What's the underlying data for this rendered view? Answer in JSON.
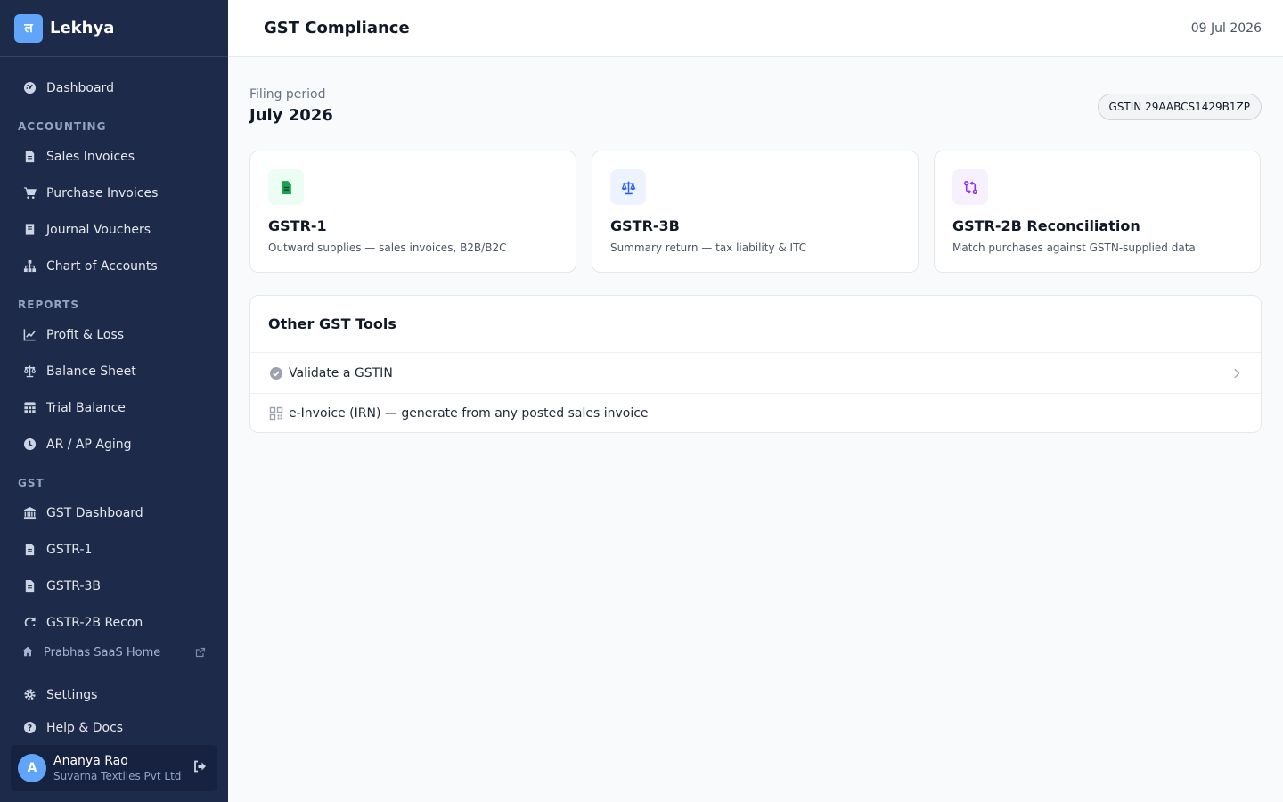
{
  "brand": {
    "logo_glyph": "ल",
    "name": "Lekhya",
    "accent": "#60a5fa"
  },
  "sidebar": {
    "items": [
      {
        "type": "item",
        "label": "Dashboard",
        "icon": "dashboard-gauge-icon"
      },
      {
        "type": "section",
        "label": "ACCOUNTING"
      },
      {
        "type": "item",
        "label": "Sales Invoices",
        "icon": "file-icon"
      },
      {
        "type": "item",
        "label": "Purchase Invoices",
        "icon": "cart-icon"
      },
      {
        "type": "item",
        "label": "Journal Vouchers",
        "icon": "book-icon"
      },
      {
        "type": "item",
        "label": "Chart of Accounts",
        "icon": "sitemap-icon"
      },
      {
        "type": "section",
        "label": "REPORTS"
      },
      {
        "type": "item",
        "label": "Profit & Loss",
        "icon": "line-chart-icon"
      },
      {
        "type": "item",
        "label": "Balance Sheet",
        "icon": "scale-icon"
      },
      {
        "type": "item",
        "label": "Trial Balance",
        "icon": "table-icon"
      },
      {
        "type": "item",
        "label": "AR / AP Aging",
        "icon": "clock-icon"
      },
      {
        "type": "section",
        "label": "GST"
      },
      {
        "type": "item",
        "label": "GST Dashboard",
        "icon": "bank-icon"
      },
      {
        "type": "item",
        "label": "GSTR-1",
        "icon": "file-icon"
      },
      {
        "type": "item",
        "label": "GSTR-3B",
        "icon": "file-icon"
      },
      {
        "type": "item",
        "label": "GSTR-2B Recon",
        "icon": "refresh-icon"
      }
    ],
    "saas_link": "Prabhas SaaS Home",
    "settings": "Settings",
    "help": "Help & Docs",
    "user": {
      "initial": "A",
      "name": "Ananya Rao",
      "org": "Suvarna Textiles Pvt Ltd"
    }
  },
  "header": {
    "title": "GST Compliance",
    "date": "09 Jul 2026"
  },
  "main": {
    "period_label": "Filing period",
    "period_value": "July 2026",
    "gstin": "GSTIN 29AABCS1429B1ZP",
    "cards": [
      {
        "title": "GSTR-1",
        "desc": "Outward supplies — sales invoices, B2B/B2C",
        "icon": "file-icon",
        "icon_color": "#16a34a",
        "icon_bg": "#ecfdf3"
      },
      {
        "title": "GSTR-3B",
        "desc": "Summary return — tax liability & ITC",
        "icon": "scale-icon",
        "icon_color": "#2563eb",
        "icon_bg": "#eef4ff"
      },
      {
        "title": "GSTR-2B Reconciliation",
        "desc": "Match purchases against GSTN-supplied data",
        "icon": "reconcile-icon",
        "icon_color": "#9333ea",
        "icon_bg": "#f6f0ff"
      }
    ],
    "tools": {
      "title": "Other GST Tools",
      "items": [
        {
          "label": "Validate a GSTIN",
          "icon": "check-circle-icon"
        },
        {
          "label": "e-Invoice (IRN) — generate from any posted sales invoice",
          "icon": "qr-code-icon"
        }
      ]
    }
  }
}
